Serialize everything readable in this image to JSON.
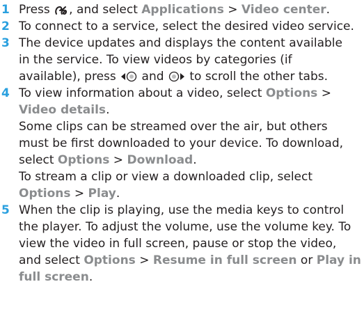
{
  "steps": [
    {
      "number": "1",
      "lines": [
        {
          "a": "Press ",
          "icon": "menu-key-icon",
          "b": ", and select ",
          "m1": "Applications",
          "c": " > ",
          "m2": "Video center",
          "d": "."
        }
      ]
    },
    {
      "number": "2",
      "text": "To connect to a service, select the desired video service."
    },
    {
      "number": "3",
      "line1": "The device updates and displays the content available",
      "line2": "in the service. To view videos by categories (if",
      "line3a": "available), press ",
      "line3b": " and ",
      "line3c": " to scroll the other tabs."
    },
    {
      "number": "4",
      "l1a": "To view information about a video, select ",
      "l1m": "Options",
      "l1b": " >",
      "l2m": "Video details",
      "l2b": ".",
      "l3": "Some clips can be streamed over the air, but others",
      "l4": "must be first downloaded to your device. To download,",
      "l5a": "select ",
      "l5m1": "Options",
      "l5b": " > ",
      "l5m2": "Download",
      "l5c": ".",
      "l6": "To stream a clip or view a downloaded clip, select",
      "l7m1": "Options",
      "l7b": " > ",
      "l7m2": "Play",
      "l7c": "."
    },
    {
      "number": "5",
      "l1": "When the clip is playing, use the media keys to control",
      "l2": "the player. To adjust the volume, use the volume key. To",
      "l3": "view the video in full screen, pause or stop the video,",
      "l4a": "and select ",
      "l4m1": "Options",
      "l4b": " > ",
      "l4m2": "Resume in full screen",
      "l4c": " or ",
      "l4m3": "Play in",
      "l5m": "full screen",
      "l5b": "."
    }
  ],
  "colors": {
    "accent": "#2aa0df",
    "menu_text": "#8a8c8e",
    "body_text": "#231f20"
  }
}
